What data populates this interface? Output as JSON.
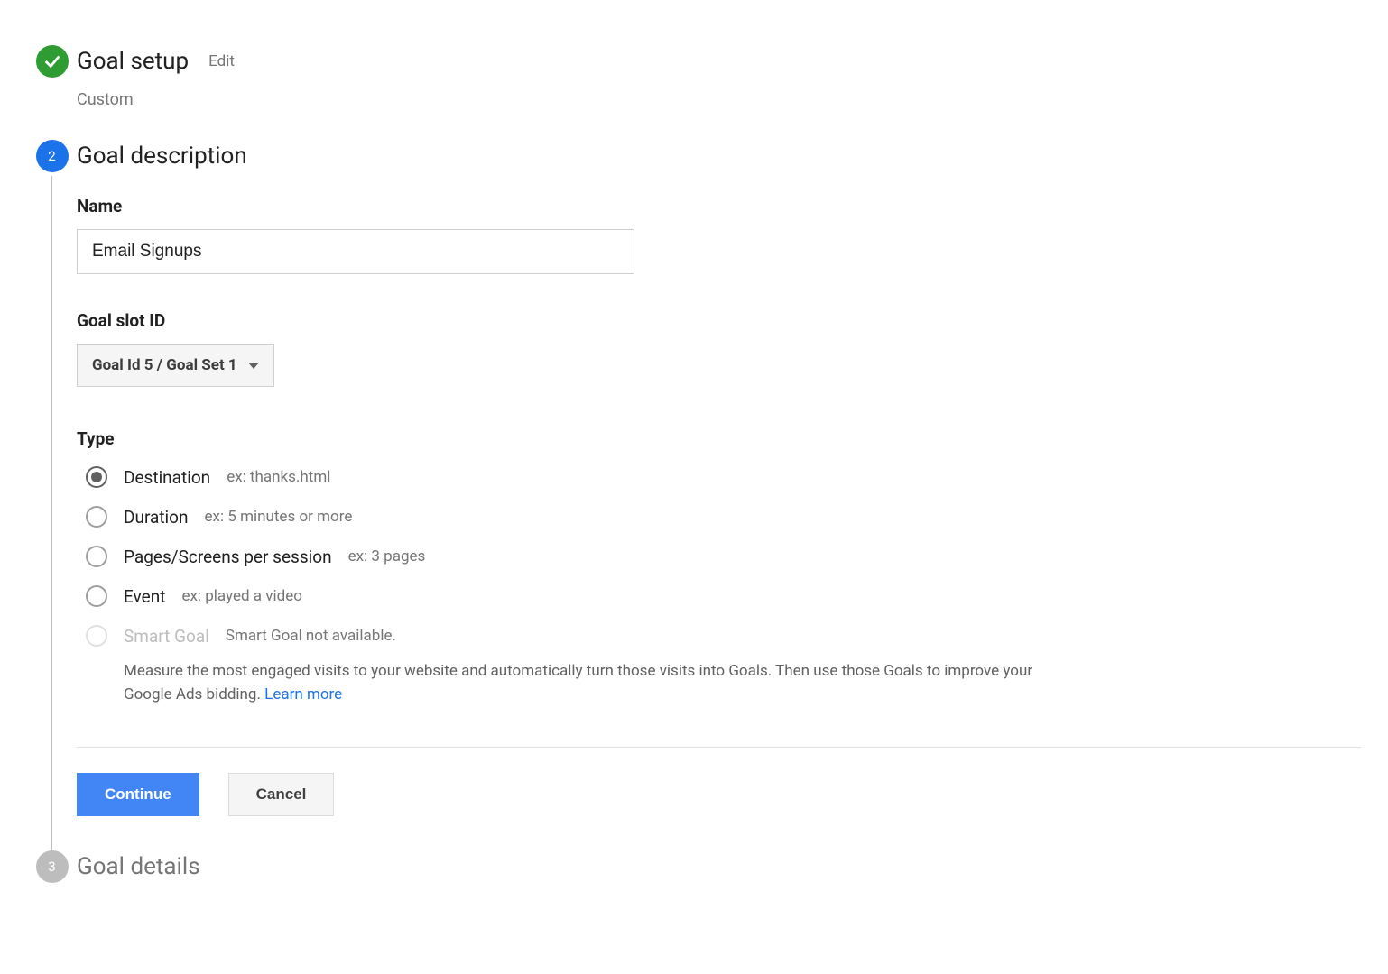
{
  "step1": {
    "title": "Goal setup",
    "edit": "Edit",
    "subtitle": "Custom"
  },
  "step2": {
    "badge": "2",
    "title": "Goal description",
    "name_label": "Name",
    "name_value": "Email Signups",
    "slot_label": "Goal slot ID",
    "slot_selected": "Goal Id 5 / Goal Set 1",
    "type_label": "Type",
    "types": [
      {
        "label": "Destination",
        "hint": "ex: thanks.html",
        "checked": true,
        "disabled": false
      },
      {
        "label": "Duration",
        "hint": "ex: 5 minutes or more",
        "checked": false,
        "disabled": false
      },
      {
        "label": "Pages/Screens per session",
        "hint": "ex: 3 pages",
        "checked": false,
        "disabled": false
      },
      {
        "label": "Event",
        "hint": "ex: played a video",
        "checked": false,
        "disabled": false
      },
      {
        "label": "Smart Goal",
        "hint": "Smart Goal not available.",
        "checked": false,
        "disabled": true
      }
    ],
    "smart_desc": "Measure the most engaged visits to your website and automatically turn those visits into Goals. Then use those Goals to improve your Google Ads bidding. ",
    "learn_more": "Learn more",
    "continue": "Continue",
    "cancel": "Cancel"
  },
  "step3": {
    "badge": "3",
    "title": "Goal details"
  }
}
